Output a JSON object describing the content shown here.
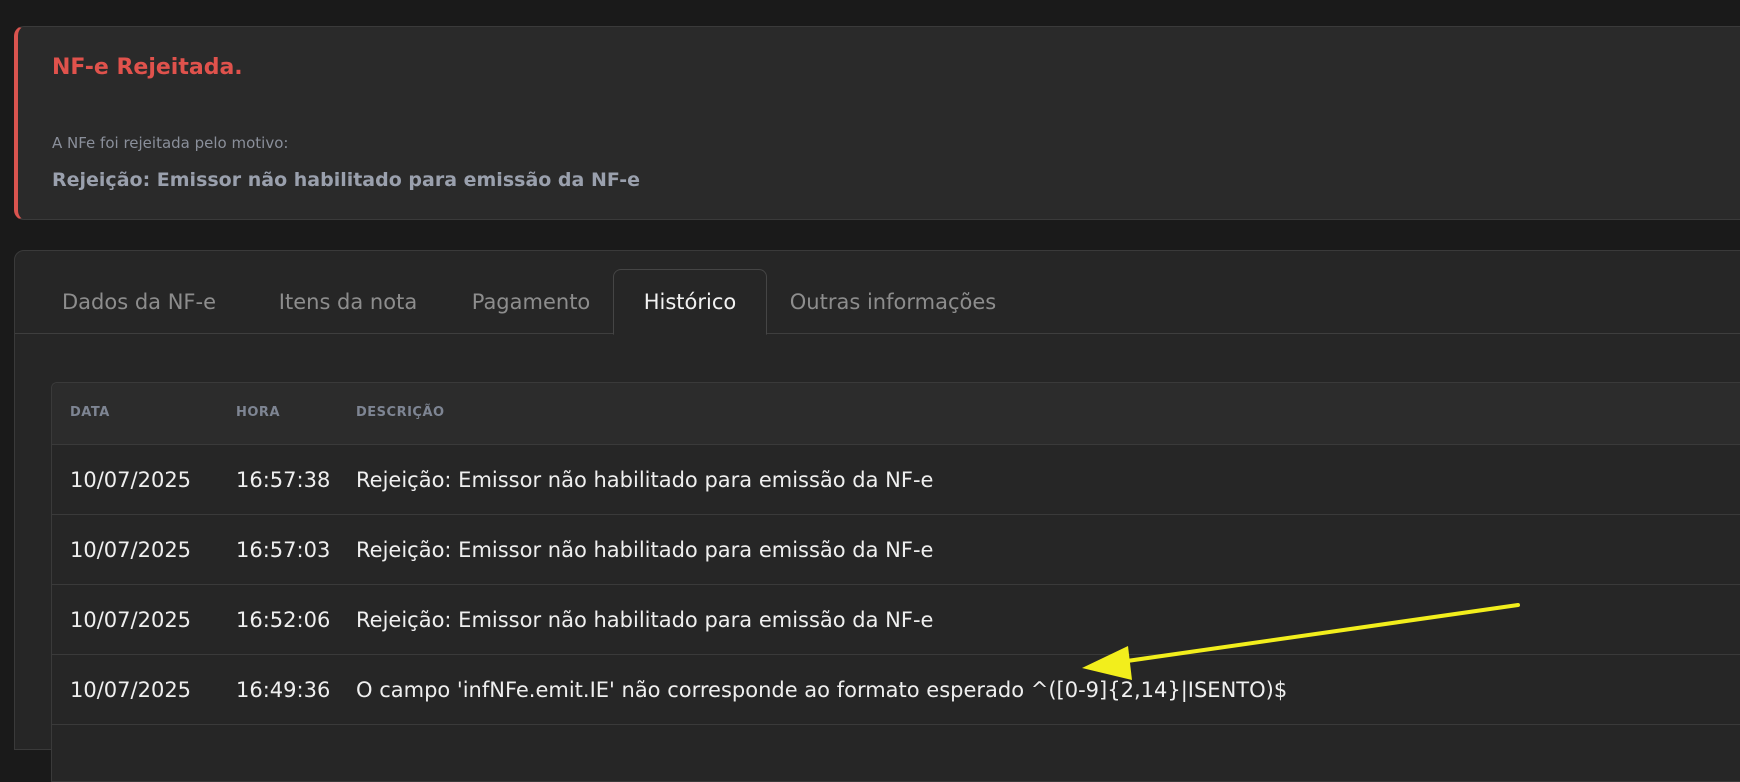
{
  "alert": {
    "title": "NF-e Rejeitada.",
    "subtitle": "A NFe foi rejeitada pelo motivo:",
    "reason": "Rejeição: Emissor não habilitado para emissão da NF-e",
    "accent_color": "#d9544f"
  },
  "tabs": [
    {
      "label": "Dados da NF-e",
      "active": false
    },
    {
      "label": "Itens da nota",
      "active": false
    },
    {
      "label": "Pagamento",
      "active": false
    },
    {
      "label": "Histórico",
      "active": true
    },
    {
      "label": "Outras informações",
      "active": false
    }
  ],
  "history_table": {
    "columns": [
      "DATA",
      "HORA",
      "DESCRIÇÃO"
    ],
    "rows": [
      {
        "data": "10/07/2025",
        "hora": "16:57:38",
        "descricao": "Rejeição: Emissor não habilitado para emissão da NF-e"
      },
      {
        "data": "10/07/2025",
        "hora": "16:57:03",
        "descricao": "Rejeição: Emissor não habilitado para emissão da NF-e"
      },
      {
        "data": "10/07/2025",
        "hora": "16:52:06",
        "descricao": "Rejeição: Emissor não habilitado para emissão da NF-e"
      },
      {
        "data": "10/07/2025",
        "hora": "16:49:36",
        "descricao": "O campo 'infNFe.emit.IE' não corresponde ao formato esperado ^([0-9]{2,14}|ISENTO)$"
      }
    ]
  },
  "annotation": {
    "arrow_color": "#f2ee1c"
  }
}
